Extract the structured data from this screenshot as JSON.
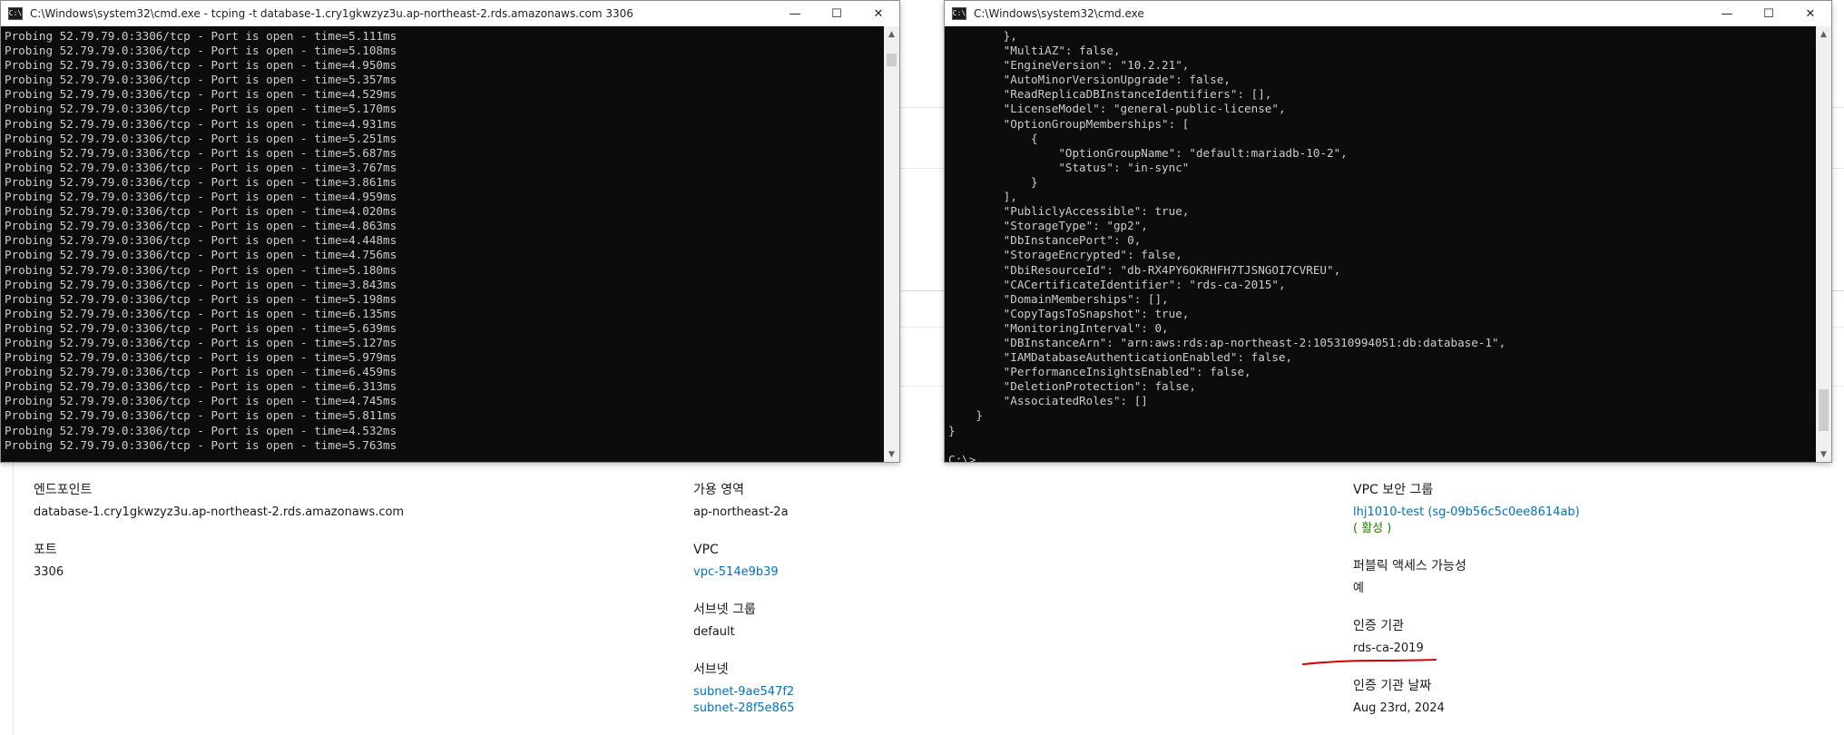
{
  "aws": {
    "col1": {
      "endpoint_label": "엔드포인트",
      "endpoint_value": "database-1.cry1gkwzyz3u.ap-northeast-2.rds.amazonaws.com",
      "port_label": "포트",
      "port_value": "3306"
    },
    "col2": {
      "az_label": "가용 영역",
      "az_value": "ap-northeast-2a",
      "vpc_label": "VPC",
      "vpc_value": "vpc-514e9b39",
      "subnet_group_label": "서브넷 그룹",
      "subnet_group_value": "default",
      "subnets_label": "서브넷",
      "subnets": [
        "subnet-9ae547f2",
        "subnet-28f5e865"
      ]
    },
    "col3": {
      "sg_label": "VPC 보안 그룹",
      "sg_value": "lhj1010-test (sg-09b56c5c0ee8614ab)",
      "sg_status": "( 활성 )",
      "public_label": "퍼블릭 액세스 가능성",
      "public_value": "예",
      "ca_label": "인증 기관",
      "ca_value": "rds-ca-2019",
      "ca_date_label": "인증 기관 날짜",
      "ca_date_value": "Aug 23rd, 2024"
    },
    "annotation_color": "#d40000"
  },
  "left_window": {
    "title": "C:\\Windows\\system32\\cmd.exe - tcping  -t database-1.cry1gkwzyz3u.ap-northeast-2.rds.amazonaws.com 3306",
    "icon": "cmd-icon",
    "lines": [
      "Probing 52.79.79.0:3306/tcp - Port is open - time=5.111ms",
      "Probing 52.79.79.0:3306/tcp - Port is open - time=5.108ms",
      "Probing 52.79.79.0:3306/tcp - Port is open - time=4.950ms",
      "Probing 52.79.79.0:3306/tcp - Port is open - time=5.357ms",
      "Probing 52.79.79.0:3306/tcp - Port is open - time=4.529ms",
      "Probing 52.79.79.0:3306/tcp - Port is open - time=5.170ms",
      "Probing 52.79.79.0:3306/tcp - Port is open - time=4.931ms",
      "Probing 52.79.79.0:3306/tcp - Port is open - time=5.251ms",
      "Probing 52.79.79.0:3306/tcp - Port is open - time=5.687ms",
      "Probing 52.79.79.0:3306/tcp - Port is open - time=3.767ms",
      "Probing 52.79.79.0:3306/tcp - Port is open - time=3.861ms",
      "Probing 52.79.79.0:3306/tcp - Port is open - time=4.959ms",
      "Probing 52.79.79.0:3306/tcp - Port is open - time=4.020ms",
      "Probing 52.79.79.0:3306/tcp - Port is open - time=4.863ms",
      "Probing 52.79.79.0:3306/tcp - Port is open - time=4.448ms",
      "Probing 52.79.79.0:3306/tcp - Port is open - time=4.756ms",
      "Probing 52.79.79.0:3306/tcp - Port is open - time=5.180ms",
      "Probing 52.79.79.0:3306/tcp - Port is open - time=3.843ms",
      "Probing 52.79.79.0:3306/tcp - Port is open - time=5.198ms",
      "Probing 52.79.79.0:3306/tcp - Port is open - time=6.135ms",
      "Probing 52.79.79.0:3306/tcp - Port is open - time=5.639ms",
      "Probing 52.79.79.0:3306/tcp - Port is open - time=5.127ms",
      "Probing 52.79.79.0:3306/tcp - Port is open - time=5.979ms",
      "Probing 52.79.79.0:3306/tcp - Port is open - time=6.459ms",
      "Probing 52.79.79.0:3306/tcp - Port is open - time=6.313ms",
      "Probing 52.79.79.0:3306/tcp - Port is open - time=4.745ms",
      "Probing 52.79.79.0:3306/tcp - Port is open - time=5.811ms",
      "Probing 52.79.79.0:3306/tcp - Port is open - time=4.532ms",
      "Probing 52.79.79.0:3306/tcp - Port is open - time=5.763ms"
    ]
  },
  "right_window": {
    "title": "C:\\Windows\\system32\\cmd.exe",
    "icon": "cmd-icon",
    "lines": [
      "        },",
      "        \"MultiAZ\": false,",
      "        \"EngineVersion\": \"10.2.21\",",
      "        \"AutoMinorVersionUpgrade\": false,",
      "        \"ReadReplicaDBInstanceIdentifiers\": [],",
      "        \"LicenseModel\": \"general-public-license\",",
      "        \"OptionGroupMemberships\": [",
      "            {",
      "                \"OptionGroupName\": \"default:mariadb-10-2\",",
      "                \"Status\": \"in-sync\"",
      "            }",
      "        ],",
      "        \"PubliclyAccessible\": true,",
      "        \"StorageType\": \"gp2\",",
      "        \"DbInstancePort\": 0,",
      "        \"StorageEncrypted\": false,",
      "        \"DbiResourceId\": \"db-RX4PY6OKRHFH7TJSNGOI7CVREU\",",
      "        \"CACertificateIdentifier\": \"rds-ca-2015\",",
      "        \"DomainMemberships\": [],",
      "        \"CopyTagsToSnapshot\": true,",
      "        \"MonitoringInterval\": 0,",
      "        \"DBInstanceArn\": \"arn:aws:rds:ap-northeast-2:105310994051:db:database-1\",",
      "        \"IAMDatabaseAuthenticationEnabled\": false,",
      "        \"PerformanceInsightsEnabled\": false,",
      "        \"DeletionProtection\": false,",
      "        \"AssociatedRoles\": []",
      "    }",
      "}",
      "",
      "C:\\>"
    ]
  },
  "window_controls": {
    "minimize": "—",
    "maximize": "☐",
    "close": "✕"
  },
  "colors": {
    "console_bg": "#0c0c0c",
    "console_fg": "#cccccc",
    "link": "#0073bb"
  }
}
